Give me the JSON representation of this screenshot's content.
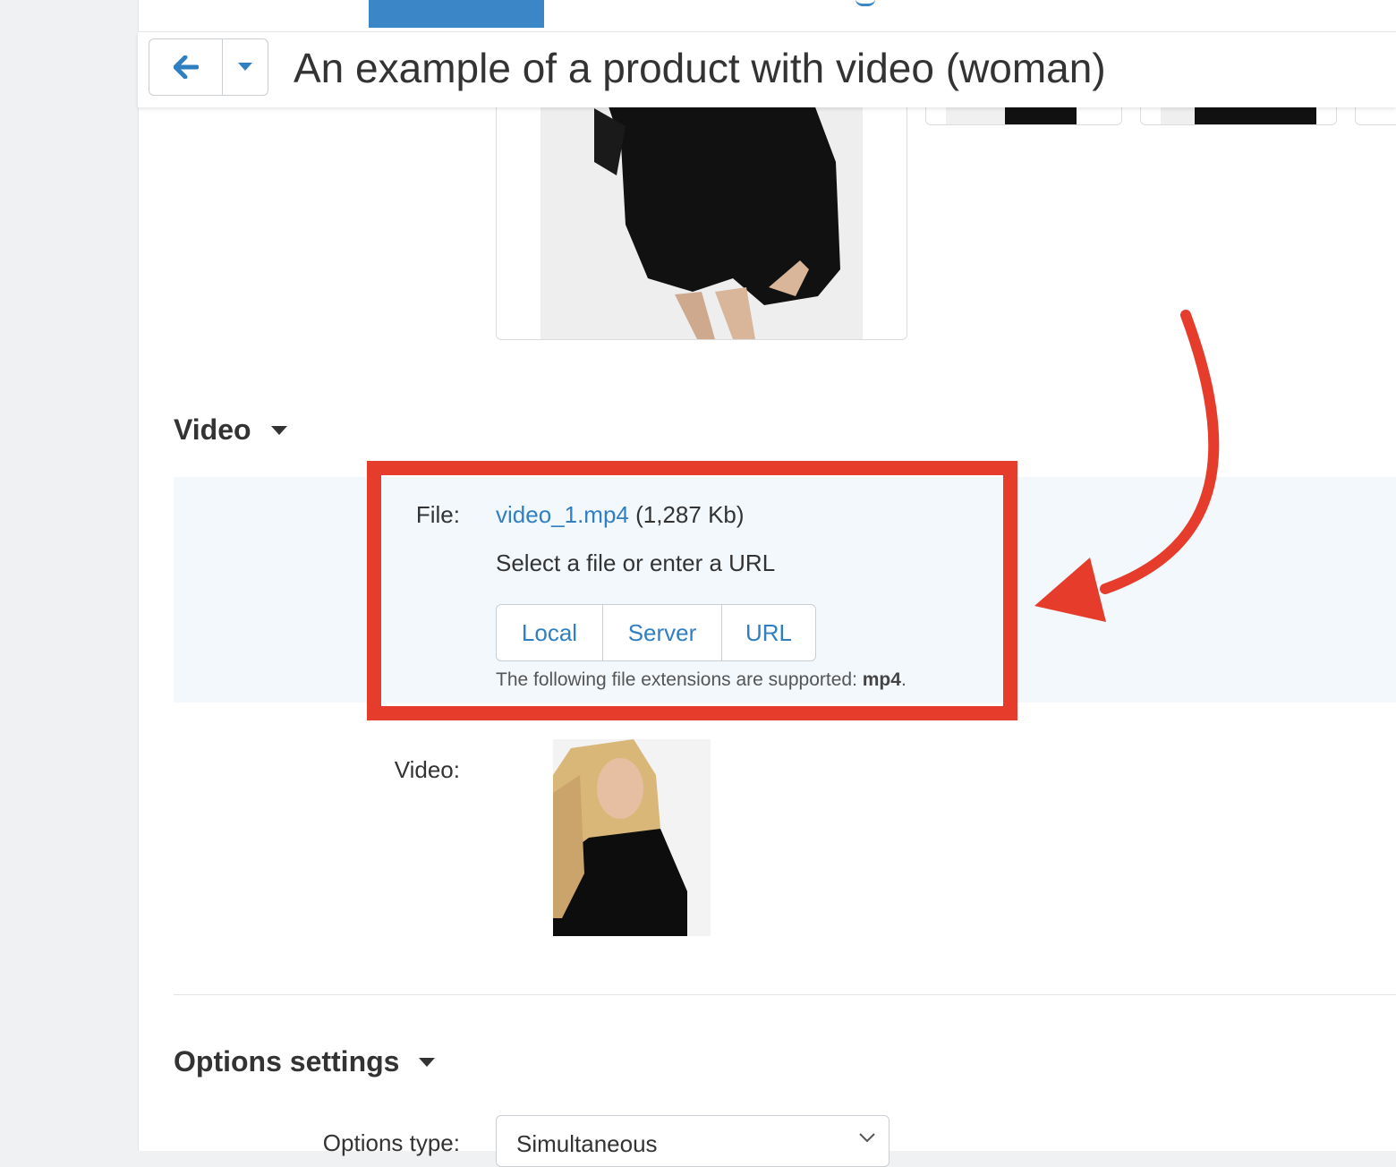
{
  "header": {
    "title": "An example of a product with video (woman)",
    "back_icon": "arrow-left-icon",
    "menu_icon": "caret-down-icon"
  },
  "video_section": {
    "title": "Video",
    "file_label": "File:",
    "file_name": "video_1.mp4",
    "file_size": "(1,287 Kb)",
    "select_prompt": "Select a file or enter a URL",
    "source_buttons": [
      "Local",
      "Server",
      "URL"
    ],
    "hint_prefix": "The following file extensions are supported: ",
    "hint_ext": "mp4",
    "hint_suffix": ".",
    "video_label": "Video:"
  },
  "options_section": {
    "title": "Options settings",
    "options_type_label": "Options type:",
    "options_type_value": "Simultaneous"
  },
  "colors": {
    "accent": "#3b86c6",
    "link": "#2f7fc2",
    "highlight": "#e53c2b",
    "panel": "#f3f8fc"
  }
}
